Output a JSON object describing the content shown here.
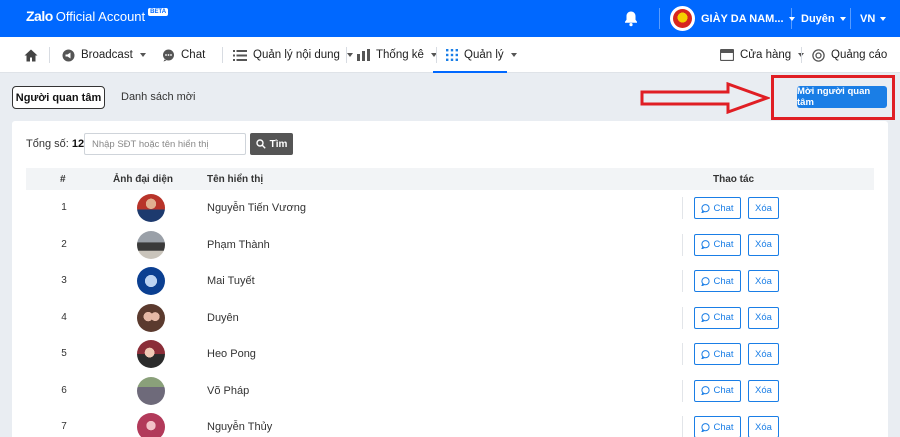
{
  "app": {
    "logo_zalo": "Zalo",
    "logo_text": "Official Account",
    "beta": "BETA"
  },
  "topbar": {
    "account_name": "GIÀY DA NAM...",
    "user_name": "Duyên",
    "language": "VN"
  },
  "nav": {
    "items": [
      {
        "label": "Broadcast",
        "icon": "megaphone-icon"
      },
      {
        "label": "Chat",
        "icon": "chat-icon"
      },
      {
        "label": "Quản lý nội dung",
        "icon": "list-icon"
      },
      {
        "label": "Thống kê",
        "icon": "bar-chart-icon"
      },
      {
        "label": "Quản lý",
        "icon": "grid-icon"
      },
      {
        "label": "Cửa hàng",
        "icon": "store-icon"
      },
      {
        "label": "Quảng cáo",
        "icon": "ads-icon"
      }
    ],
    "active": "Quản lý"
  },
  "subnav": {
    "tab_active": "Người quan tâm",
    "tab_other": "Danh sách mời",
    "invite_button": "Mời người quan tâm"
  },
  "search": {
    "total_label": "Tổng số:",
    "total_value": "12",
    "placeholder": "Nhập SĐT hoặc tên hiển thị",
    "button": "Tìm"
  },
  "table": {
    "headers": {
      "index": "#",
      "avatar": "Ảnh đại diện",
      "name": "Tên hiển thị",
      "actions": "Thao tác"
    },
    "chat_label": "Chat",
    "delete_label": "Xóa",
    "rows": [
      {
        "index": "1",
        "name": "Nguyễn Tiến Vương"
      },
      {
        "index": "2",
        "name": "Phạm Thành"
      },
      {
        "index": "3",
        "name": "Mai Tuyết"
      },
      {
        "index": "4",
        "name": "Duyên"
      },
      {
        "index": "5",
        "name": "Heo Pong"
      },
      {
        "index": "6",
        "name": "Võ Pháp"
      },
      {
        "index": "7",
        "name": "Nguyễn Thủy"
      }
    ]
  },
  "colors": {
    "brand": "#0068ff",
    "button": "#1a7ee6",
    "highlight": "#e01e24"
  }
}
